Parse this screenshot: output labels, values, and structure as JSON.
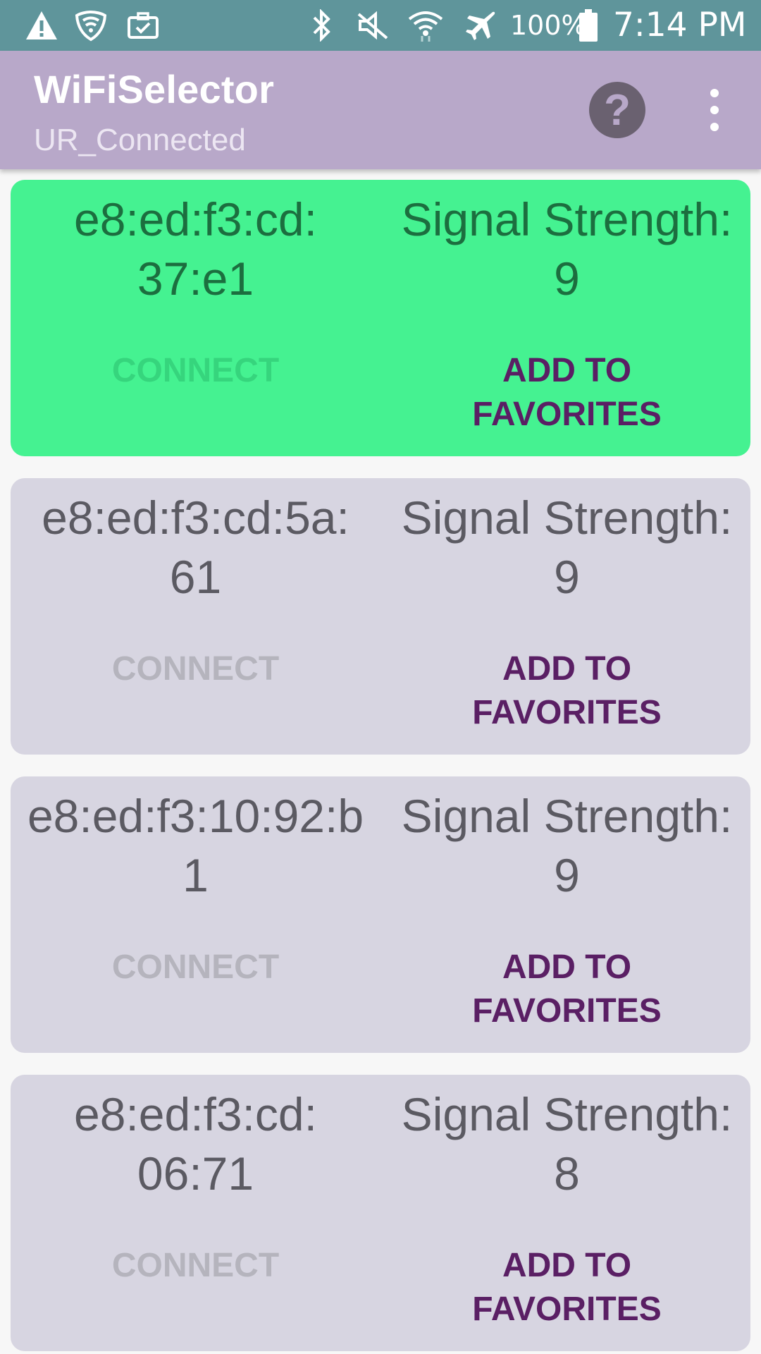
{
  "status_bar": {
    "battery": "100%",
    "time": "7:14 PM",
    "icons": [
      "warning-icon",
      "wifi-shield-icon",
      "briefcase-check-icon",
      "bluetooth-icon",
      "mute-icon",
      "wifi-signal-icon",
      "airplane-icon",
      "battery-icon"
    ]
  },
  "app_bar": {
    "title": "WiFiSelector",
    "subtitle": "UR_Connected",
    "help_label": "?"
  },
  "networks": [
    {
      "bssid_line1": "e8:ed:f3:cd:",
      "bssid_line2": "37:e1",
      "signal_label": "Signal Strength:",
      "signal": "9",
      "connect": "CONNECT",
      "fav_line1": "ADD TO",
      "fav_line2": "FAVORITES",
      "active": true
    },
    {
      "bssid_line1": "e8:ed:f3:cd:5a:",
      "bssid_line2": "61",
      "signal_label": "Signal Strength:",
      "signal": "9",
      "connect": "CONNECT",
      "fav_line1": "ADD TO",
      "fav_line2": "FAVORITES",
      "active": false
    },
    {
      "bssid_line1": "e8:ed:f3:10:92:b",
      "bssid_line2": "1",
      "signal_label": "Signal Strength:",
      "signal": "9",
      "connect": "CONNECT",
      "fav_line1": "ADD TO",
      "fav_line2": "FAVORITES",
      "active": false
    },
    {
      "bssid_line1": "e8:ed:f3:cd:",
      "bssid_line2": "06:71",
      "signal_label": "Signal Strength:",
      "signal": "8",
      "connect": "CONNECT",
      "fav_line1": "ADD TO",
      "fav_line2": "FAVORITES",
      "active": false
    }
  ],
  "colors": {
    "status_bar": "#5f959b",
    "app_bar": "#b8a8c9",
    "active_card": "#45f291",
    "card": "#d7d5e1",
    "favorites_text": "#5a1f64"
  }
}
